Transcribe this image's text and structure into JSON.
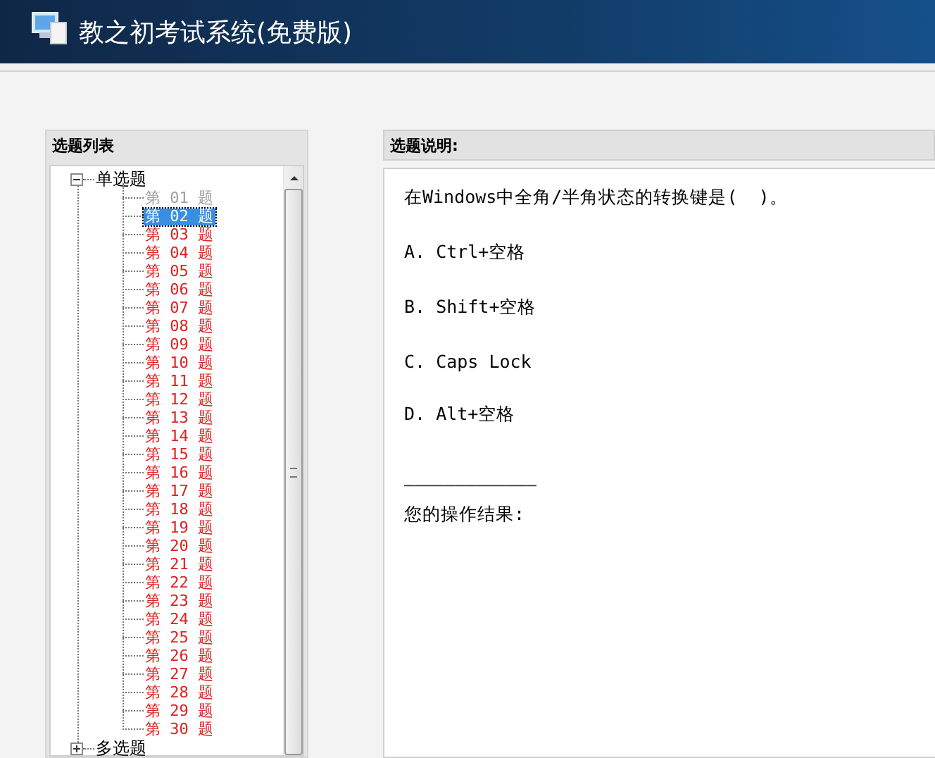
{
  "window": {
    "title": "教之初考试系统(免费版)"
  },
  "question_list": {
    "title": "选题列表",
    "groups": [
      {
        "label": "单选题",
        "expanded": true,
        "children": [
          {
            "label": "第 01 题",
            "selected": false,
            "answered": true
          },
          {
            "label": "第 02 题",
            "selected": true,
            "answered": false
          },
          {
            "label": "第 03 题",
            "selected": false,
            "answered": false
          },
          {
            "label": "第 04 题",
            "selected": false,
            "answered": false
          },
          {
            "label": "第 05 题",
            "selected": false,
            "answered": false
          },
          {
            "label": "第 06 题",
            "selected": false,
            "answered": false
          },
          {
            "label": "第 07 题",
            "selected": false,
            "answered": false
          },
          {
            "label": "第 08 题",
            "selected": false,
            "answered": false
          },
          {
            "label": "第 09 题",
            "selected": false,
            "answered": false
          },
          {
            "label": "第 10 题",
            "selected": false,
            "answered": false
          },
          {
            "label": "第 11 题",
            "selected": false,
            "answered": false
          },
          {
            "label": "第 12 题",
            "selected": false,
            "answered": false
          },
          {
            "label": "第 13 题",
            "selected": false,
            "answered": false
          },
          {
            "label": "第 14 题",
            "selected": false,
            "answered": false
          },
          {
            "label": "第 15 题",
            "selected": false,
            "answered": false
          },
          {
            "label": "第 16 题",
            "selected": false,
            "answered": false
          },
          {
            "label": "第 17 题",
            "selected": false,
            "answered": false
          },
          {
            "label": "第 18 题",
            "selected": false,
            "answered": false
          },
          {
            "label": "第 19 题",
            "selected": false,
            "answered": false
          },
          {
            "label": "第 20 题",
            "selected": false,
            "answered": false
          },
          {
            "label": "第 21 题",
            "selected": false,
            "answered": false
          },
          {
            "label": "第 22 题",
            "selected": false,
            "answered": false
          },
          {
            "label": "第 23 题",
            "selected": false,
            "answered": false
          },
          {
            "label": "第 24 题",
            "selected": false,
            "answered": false
          },
          {
            "label": "第 25 题",
            "selected": false,
            "answered": false
          },
          {
            "label": "第 26 题",
            "selected": false,
            "answered": false
          },
          {
            "label": "第 27 题",
            "selected": false,
            "answered": false
          },
          {
            "label": "第 28 题",
            "selected": false,
            "answered": false
          },
          {
            "label": "第 29 题",
            "selected": false,
            "answered": false
          },
          {
            "label": "第 30 题",
            "selected": false,
            "answered": false
          }
        ]
      },
      {
        "label": "多选题",
        "expanded": false
      }
    ]
  },
  "question_detail": {
    "title": "选题说明:",
    "question": "在Windows中全角/半角状态的转换键是(  )。",
    "options": [
      "A. Ctrl+空格",
      "B. Shift+空格",
      "C. Caps Lock",
      "D. Alt+空格"
    ],
    "separator": "—————————————",
    "result_label": "您的操作结果:"
  }
}
